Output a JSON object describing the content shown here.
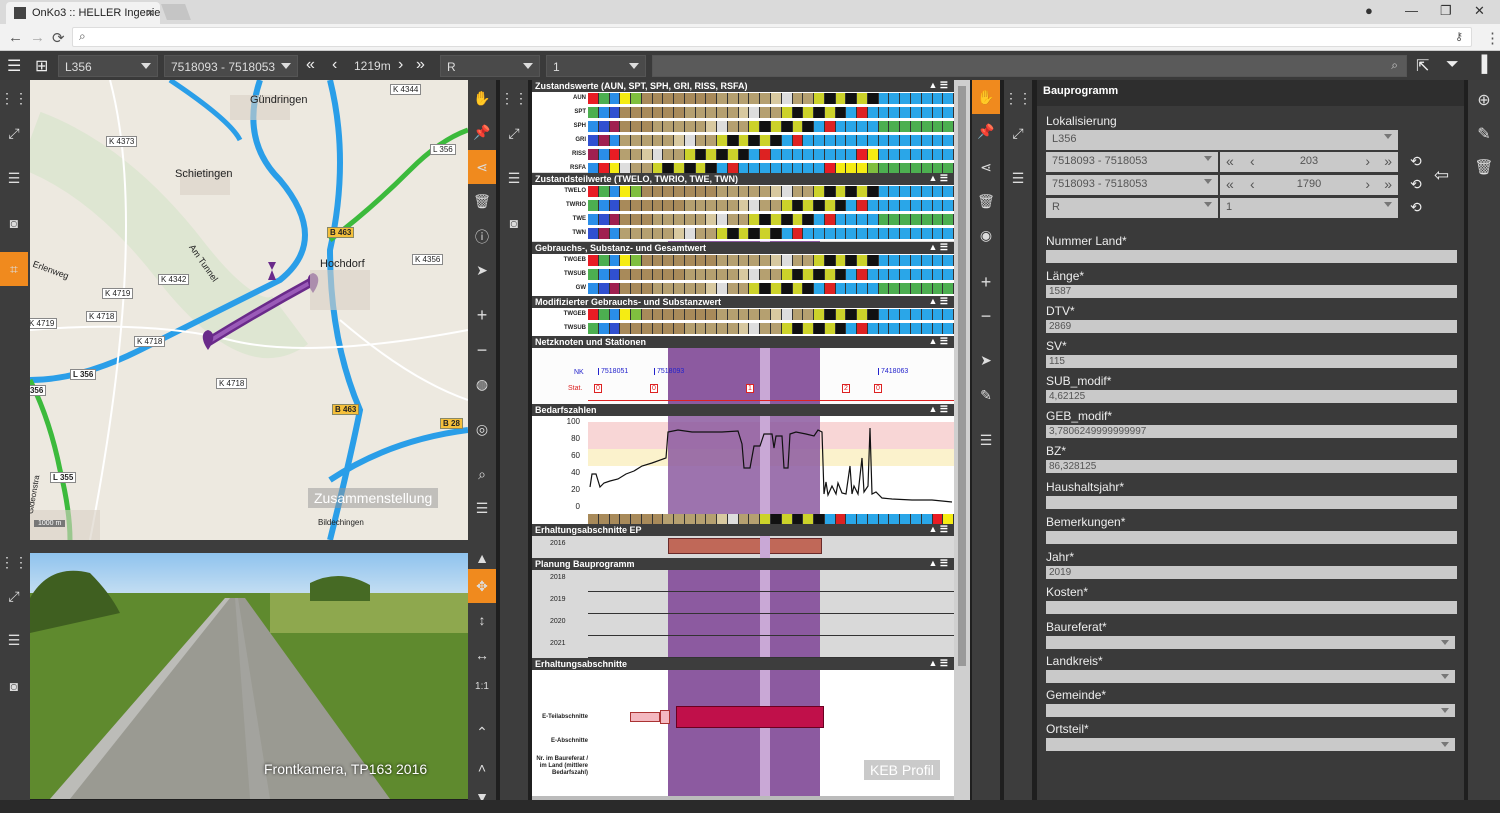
{
  "browser": {
    "tab_title": "OnKo3 :: HELLER Ingenieu"
  },
  "toolbar": {
    "road": "L356",
    "section": "7518093 - 7518053",
    "distance": "1219m",
    "direction": "R",
    "lane": "1"
  },
  "map": {
    "places": [
      "Gündringen",
      "Schietingen",
      "Hochdorf",
      "Erlenweg",
      "Am Tunnel",
      "Bildechingen",
      "Gideonstra"
    ],
    "roads": [
      "K 4344",
      "K 4373",
      "L 356",
      "B 463",
      "K 4356",
      "K 4719",
      "K 4718",
      "K 4342",
      "K 4719",
      "K 4718",
      "K 4718",
      "L 356",
      "L 356",
      "B 463",
      "B 28",
      "L 355",
      "355"
    ],
    "scale": "1000 m",
    "overlay": "Zusammenstellung"
  },
  "photo": {
    "caption": "Frontkamera, TP163 2016"
  },
  "photo_side": {
    "ratio": "1:1"
  },
  "profile": {
    "sections": [
      {
        "title": "Zustandswerte (AUN, SPT, SPH, GRI, RISS, RSFA)",
        "rows": [
          "AUN",
          "SPT",
          "SPH",
          "GRI",
          "RISS",
          "RSFA"
        ]
      },
      {
        "title": "Zustandsteilwerte (TWELO, TWRIO, TWE, TWN)",
        "rows": [
          "TWELO",
          "TWRIO",
          "TWE",
          "TWN"
        ]
      },
      {
        "title": "Gebrauchs-, Substanz- und Gesamtwert",
        "rows": [
          "TWGEB",
          "TWSUB",
          "GW"
        ]
      },
      {
        "title": "Modifizierter Gebrauchs- und Substanzwert",
        "rows": [
          "TWGEB",
          "TWSUB"
        ]
      },
      {
        "title": "Netzknoten und Stationen",
        "rows": []
      },
      {
        "title": "Bedarfszahlen",
        "rows": []
      },
      {
        "title": "Erhaltungsabschnitte EP",
        "rows": []
      },
      {
        "title": "Planung Bauprogramm",
        "rows": []
      },
      {
        "title": "Erhaltungsabschnitte",
        "rows": []
      }
    ],
    "nk_label": "NK",
    "stat_label": "Stat.",
    "nodes": [
      "7518051",
      "7518093",
      "7418063"
    ],
    "stations": [
      "0",
      "0",
      "1",
      "2",
      "0"
    ],
    "bedarf_ticks": [
      "100",
      "80",
      "60",
      "40",
      "20",
      "0"
    ],
    "ep_year": "2016",
    "plan_years": [
      "2018",
      "2019",
      "2020",
      "2021"
    ],
    "erh_labels": [
      "E-Teilabschnitte",
      "E-Abschnitte",
      "Nr. im Baureferat / im Land (mittlere Bedarfszahl)"
    ],
    "watermark": "KEB Profil"
  },
  "form": {
    "title": "Bauprogramm",
    "loc_label": "Lokalisierung",
    "loc_road": "L356",
    "loc_rows": [
      {
        "section": "7518093 - 7518053",
        "value": "203"
      },
      {
        "section": "7518093 - 7518053",
        "value": "1790"
      }
    ],
    "loc_dir": "R",
    "loc_lane": "1",
    "fields": [
      {
        "label": "Nummer Land*",
        "value": ""
      },
      {
        "label": "Länge*",
        "value": "1587"
      },
      {
        "label": "DTV*",
        "value": "2869"
      },
      {
        "label": "SV*",
        "value": "115"
      },
      {
        "label": "SUB_modif*",
        "value": "4,62125"
      },
      {
        "label": "GEB_modif*",
        "value": "3,7806249999999997"
      },
      {
        "label": "BZ*",
        "value": "86,328125"
      },
      {
        "label": "Haushaltsjahr*",
        "value": ""
      },
      {
        "label": "Bemerkungen*",
        "value": ""
      },
      {
        "label": "Jahr*",
        "value": "2019"
      },
      {
        "label": "Kosten*",
        "value": ""
      },
      {
        "label": "Baureferat*",
        "value": ""
      },
      {
        "label": "Landkreis*",
        "value": ""
      },
      {
        "label": "Gemeinde*",
        "value": ""
      },
      {
        "label": "Ortsteil*",
        "value": ""
      }
    ]
  },
  "colors": {
    "accent": "#f08a1e",
    "route": "#7a2a9a",
    "highlight": "#9b6fb0",
    "bar": "#c0104a"
  }
}
